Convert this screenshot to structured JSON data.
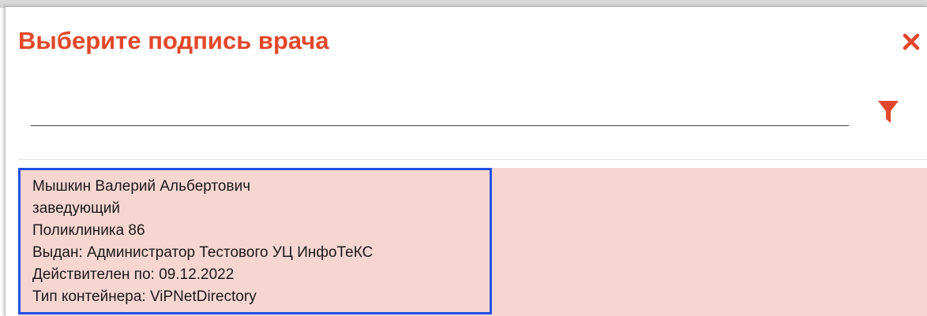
{
  "dialog": {
    "title": "Выберите подпись врача",
    "close_icon": "close-icon",
    "title_color": "#e2472a"
  },
  "search": {
    "value": "",
    "placeholder": "",
    "filter_icon": "filter-icon"
  },
  "certificates": [
    {
      "name": "Мышкин Валерий Альбертович",
      "position": "заведующий",
      "organization": "Поликлиника 86",
      "issuer": "Выдан: Администратор Тестового УЦ ИнфоТеКС",
      "valid_until": "Действителен по: 09.12.2022",
      "container": "Тип контейнера: ViPNetDirectory",
      "selected": true
    }
  ],
  "colors": {
    "accent": "#e2472a",
    "row_background": "#f7d6d2",
    "selection_border": "#2250e6"
  }
}
